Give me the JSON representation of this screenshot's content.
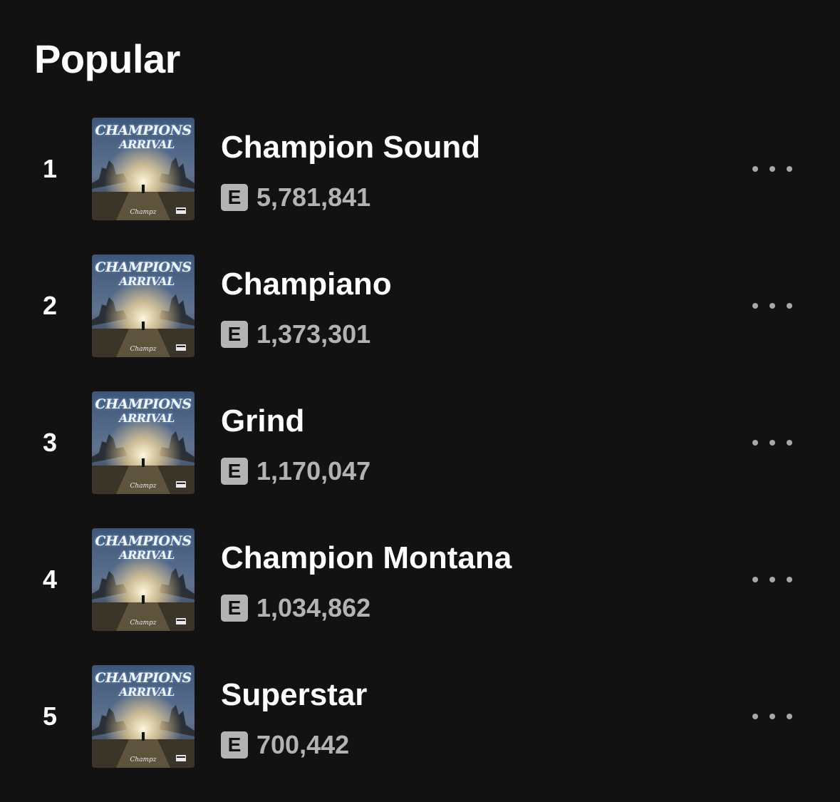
{
  "section": {
    "title": "Popular"
  },
  "album_art": {
    "line1": "CHAMPIONS",
    "line2": "ARRIVAL",
    "artist_signature": "Champz"
  },
  "explicit_label": "E",
  "tracks": [
    {
      "rank": "1",
      "title": "Champion Sound",
      "plays": "5,781,841",
      "explicit": true
    },
    {
      "rank": "2",
      "title": "Champiano",
      "plays": "1,373,301",
      "explicit": true
    },
    {
      "rank": "3",
      "title": "Grind",
      "plays": "1,170,047",
      "explicit": true
    },
    {
      "rank": "4",
      "title": "Champion Montana",
      "plays": "1,034,862",
      "explicit": true
    },
    {
      "rank": "5",
      "title": "Superstar",
      "plays": "700,442",
      "explicit": true
    }
  ],
  "icons": {
    "more": "more-options-icon",
    "explicit": "explicit-badge"
  },
  "colors": {
    "background": "#121212",
    "primary_text": "#ffffff",
    "secondary_text": "#b3b3b3",
    "badge_background": "#b3b3b3"
  }
}
